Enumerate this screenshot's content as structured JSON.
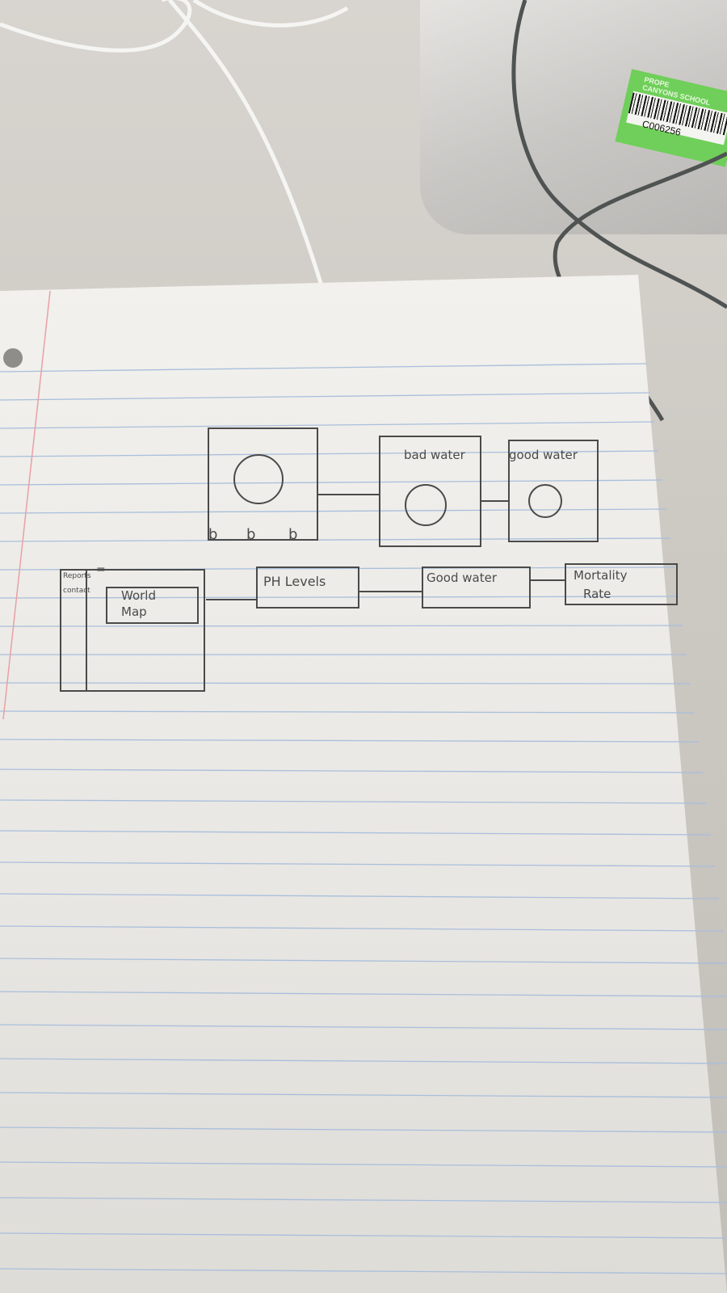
{
  "photo": {
    "sticker": {
      "line1": "PROPE",
      "line2": "CANYONS SCHOOL",
      "code": "C006256"
    },
    "row1": {
      "button_labels": [
        "b",
        "b",
        "b"
      ],
      "box_bad_label": "bad water",
      "box_good_label": "good water"
    },
    "row2": {
      "sidebar_labels": [
        "Reports",
        "contact"
      ],
      "menu_glyph": "=",
      "map_label_line1": "World",
      "map_label_line2": "Map",
      "ph_label": "PH Levels",
      "goodwater_label": "Good water",
      "mortality_line1": "Mortality",
      "mortality_line2": "Rate"
    },
    "colors": {
      "ink": "#4a4a4a",
      "rule_lines": "#a9bedc",
      "margin_line": "#e8a0a6",
      "sticker": "#6fcf5a"
    }
  }
}
